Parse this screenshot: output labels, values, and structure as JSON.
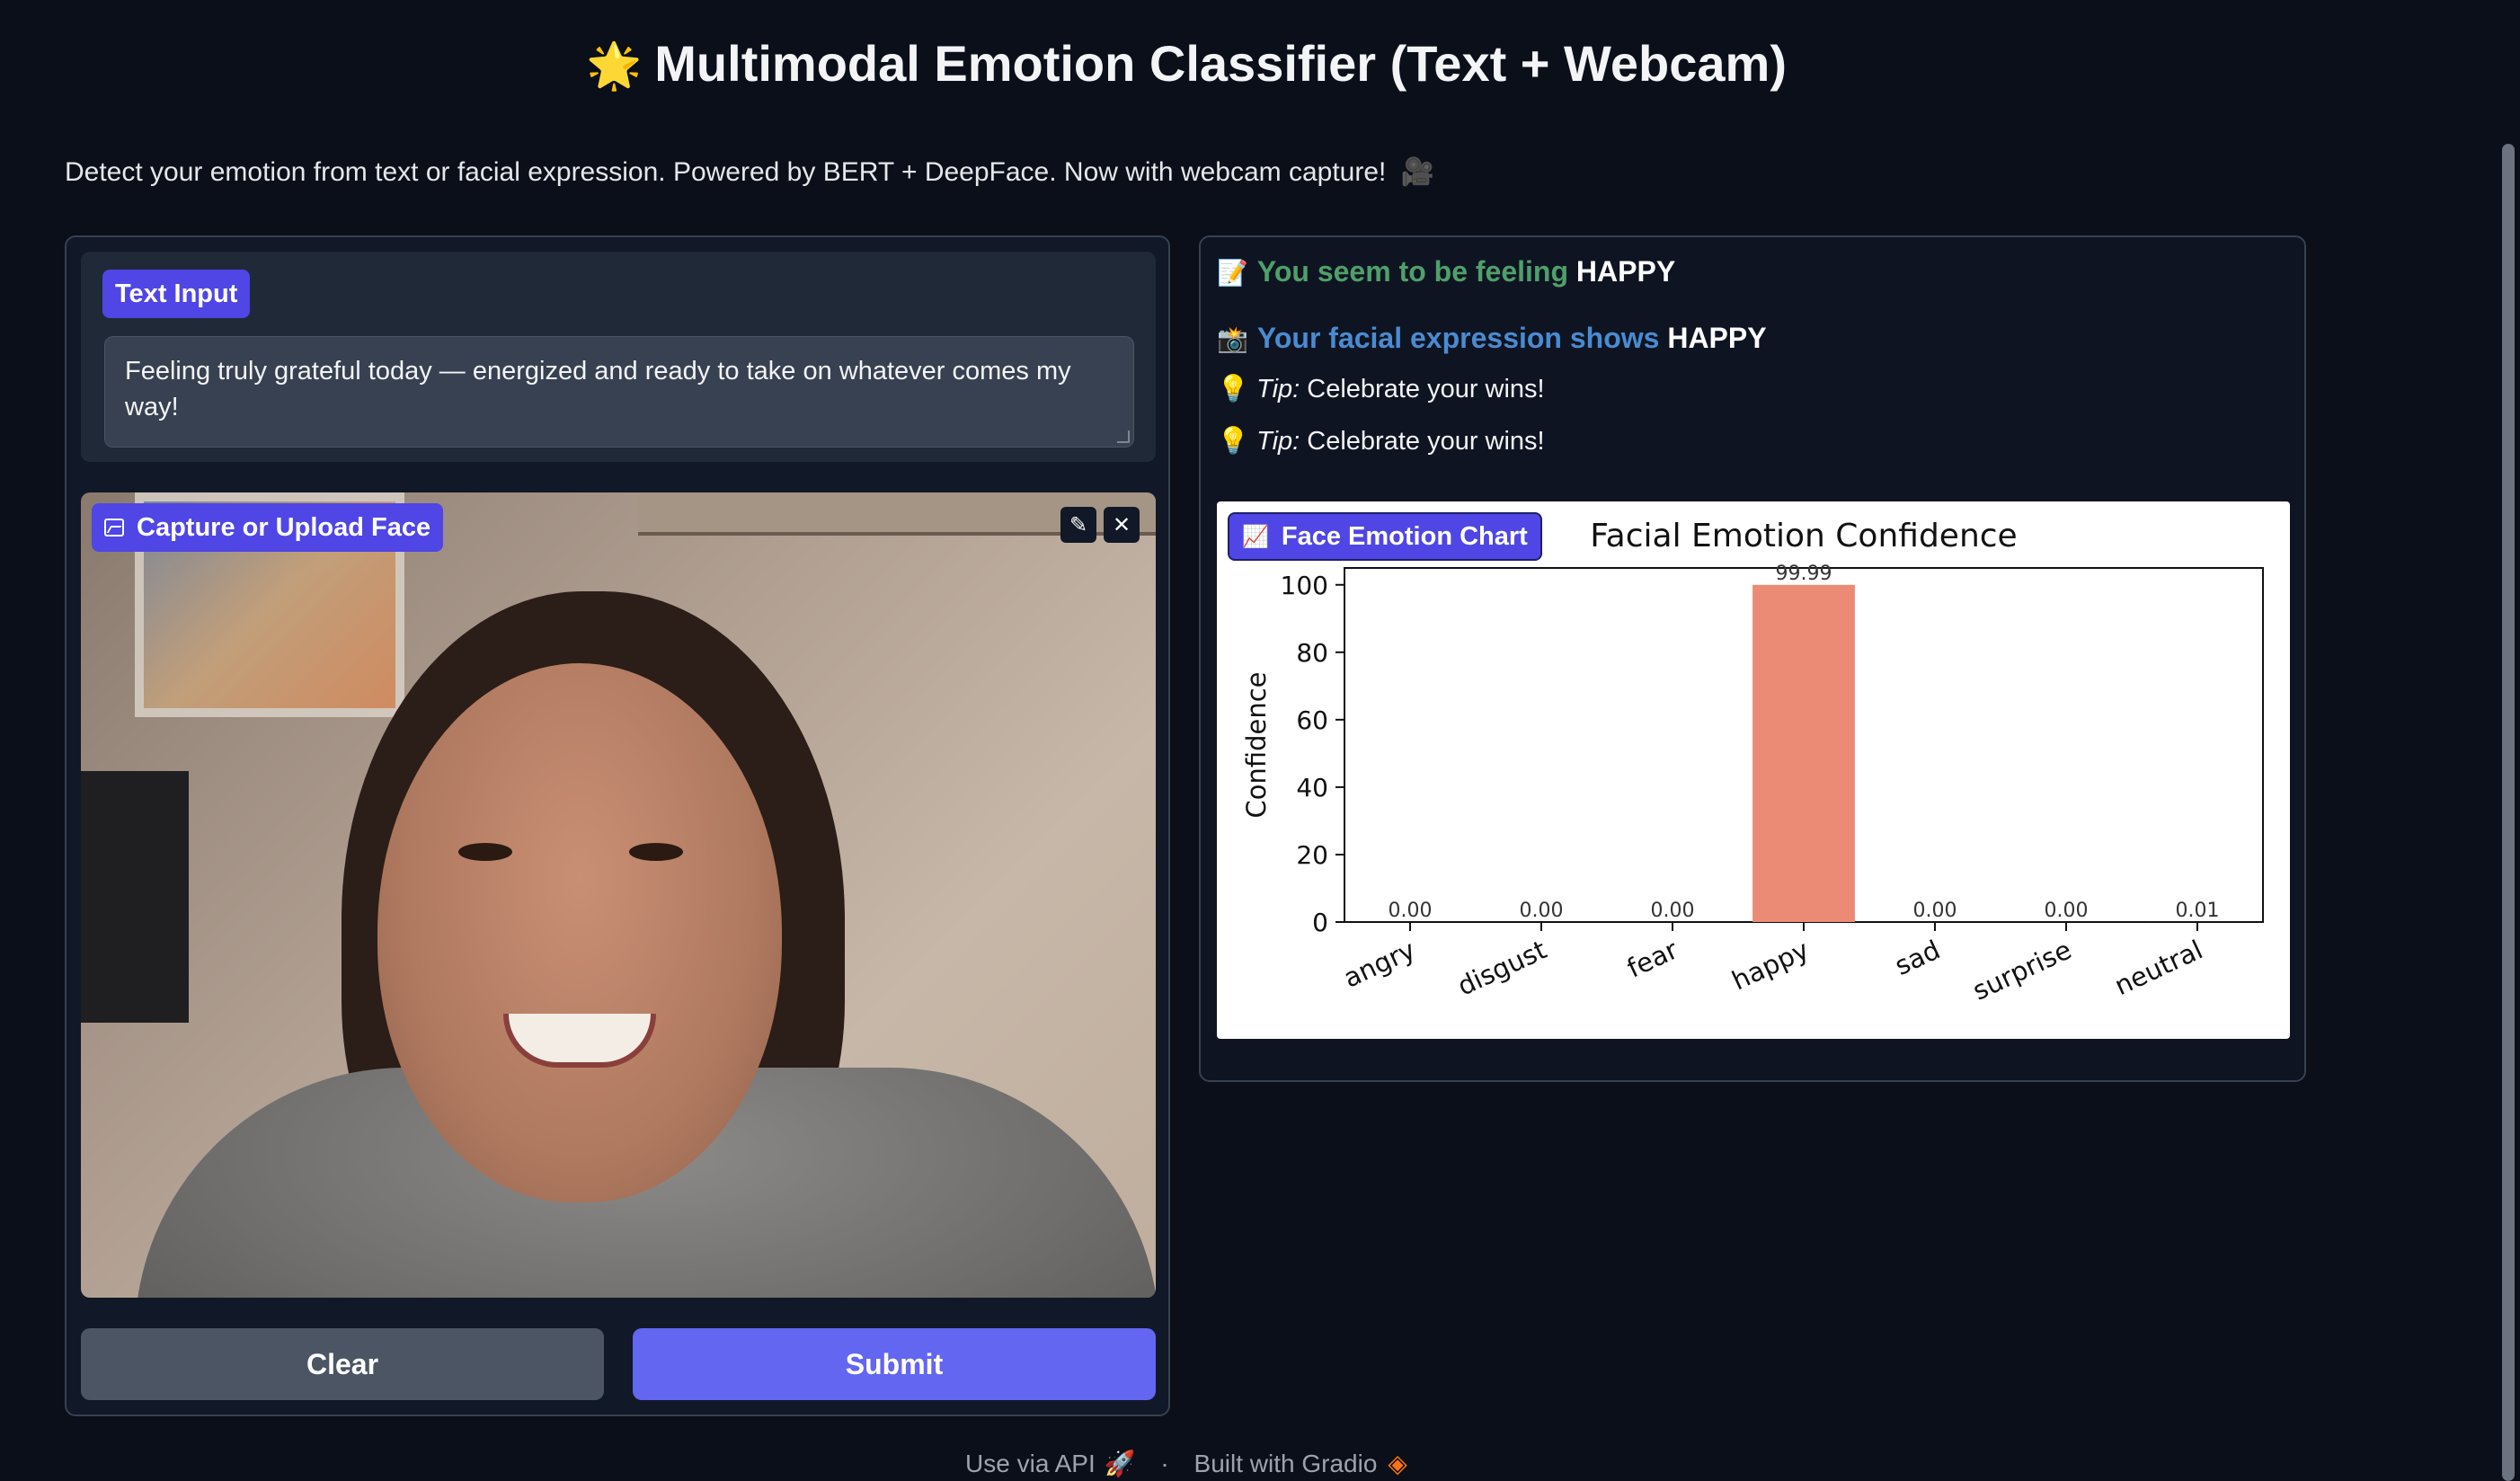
{
  "header": {
    "title_emoji": "🌟",
    "title": "Multimodal Emotion Classifier (Text + Webcam)",
    "description": "Detect your emotion from text or facial expression. Powered by BERT + DeepFace. Now with webcam capture!",
    "description_icon": "🎥"
  },
  "text_input": {
    "label": "Text Input",
    "value": "Feeling truly grateful today — energized and ready to take on whatever comes my way!"
  },
  "image_input": {
    "label": "Capture or Upload Face",
    "edit_icon": "pencil-icon",
    "clear_icon": "close-icon"
  },
  "buttons": {
    "clear": "Clear",
    "submit": "Submit"
  },
  "results": {
    "text_prefix_icon": "📝",
    "text_prefix": "You seem to be feeling",
    "text_emotion": "HAPPY",
    "face_prefix_icon": "📸",
    "face_prefix": "Your facial expression shows",
    "face_emotion": "HAPPY",
    "tips": [
      {
        "label": "Tip:",
        "text": "Celebrate your wins!"
      },
      {
        "label": "Tip:",
        "text": "Celebrate your wins!"
      }
    ]
  },
  "chart_label": "Face Emotion Chart",
  "chart_data": {
    "type": "bar",
    "title": "Facial Emotion Confidence",
    "xlabel": "",
    "ylabel": "Confidence",
    "ylim": [
      0,
      105
    ],
    "yticks": [
      0,
      20,
      40,
      60,
      80,
      100
    ],
    "categories": [
      "angry",
      "disgust",
      "fear",
      "happy",
      "sad",
      "surprise",
      "neutral"
    ],
    "values": [
      0.0,
      0.0,
      0.0,
      99.99,
      0.0,
      0.0,
      0.01
    ],
    "value_labels": [
      "0.00",
      "0.00",
      "0.00",
      "99.99",
      "0.00",
      "0.00",
      "0.01"
    ],
    "bar_color": "#ec8b75",
    "grid": false,
    "legend": "none"
  },
  "footer": {
    "api": "Use via API",
    "separator": "·",
    "built": "Built with Gradio"
  }
}
